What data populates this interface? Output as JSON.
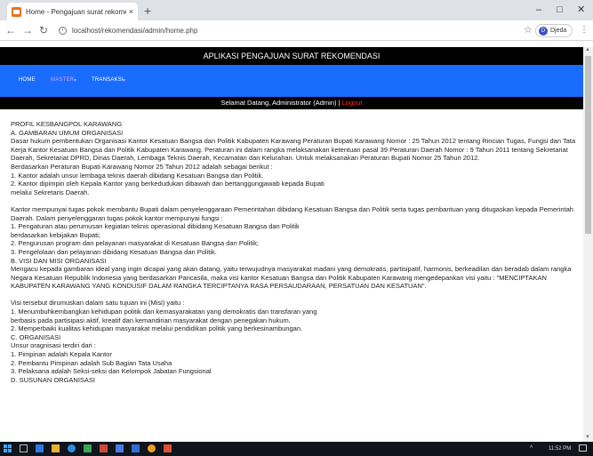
{
  "browser": {
    "tab_title": "Home - Pengajuan surat rekome",
    "tab_close": "×",
    "new_tab": "+",
    "url": "localhost/rekomendasi/admin/home.php",
    "profile_name": "Djeda",
    "profile_initial": "D",
    "minimize": "–",
    "maximize": "□",
    "close": "✕"
  },
  "page": {
    "app_title": "APLIKASI PENGAJUAN SURAT REKOMENDASI",
    "menu": [
      {
        "label": "HOME"
      },
      {
        "label": "MASTER"
      },
      {
        "label": "TRANSAKSI"
      }
    ],
    "welcome_text": "Selamat Datang, Administrator (Admin) | ",
    "logout": "Logout"
  },
  "content": {
    "lines": [
      "PROFIL KESBANGPOL KARAWANG",
      "A. GAMBARAN UMUM ORGANISASI",
      "Dasar hukum pembentukan Organisasi Kantor Kesatuan Bangsa dan Politik Kabupaten Karawang Peraturan Bupati Karawang Nomor : 25 Tahun 2012 tentang Rincian Tugas, Fungsi dan Tata Kerja Kantor Kesatuan Bangsa dan Politik Kabupaten Karawang. Peraturan ini dalam rangka melaksanakan ketentuan pasal 39 Peraturan Daerah Nomor : 9 Tahun 2011 tentang Sekretariat Daerah, Sekretariat DPRD, Dinas Daerah, Lembaga Teknis Daerah, Kecamatan dan Kelurahan. Untuk melaksanakan Peraturan Bupati Nomor 25 Tahun 2012.",
      "Berdasarkan Peraturan Bupati Karawang Nomor 25 Tahun 2012 adalah sebagai berikut :",
      "1. Kantor adalah unsur lembaga teknis daerah dibidang Kesatuan Bangsa dan Politik.",
      "2. Kantor dipimpin oleh Kepala Kantor yang berkedudukan dibawah dan bertanggungjawab kepada Bupati",
      "melalui Sekretaris Daerah.",
      "",
      "Kantor mempunyai tugas pokok membantu Bupati dalam penyelenggaraan Pemerintahan dibidang Kesatuan Bangsa dan Politik serta tugas pembantuan yang ditugaskan kepada Pemerintah Daerah. Dalam penyelenggaran tugas pokok kantor mempunyai fungsi :",
      "1. Pengaturan atau perumusan kegiatan teknis operasional dibidang Kesatuan Bangsa dan Politik",
      "berdasarkan kebijakan Bupati;",
      "2. Pengurusan program dan pelayanan masyarakat di Kesatuan Bangsa dan Politik;",
      "3. Pengelolaan dan pelayanan dibidang Kesatuan Bangsa dan Politik.",
      "B. VISI DAN MISI ORGANISASI",
      "Mengacu kepada gambaran ideal yang ingin dicapai yang akan datang, yaitu terwujudnya masyarakat madani yang demokratis, partisipatif, harmonis, berkeadilan dan beradab dalam rangka Negara Kesatuan Republik Indonesia yang berdasarkan Pancasila, maka visi kantor Kesatuan Bangsa dan Politik Kabupaten Karawang mengedepankan visi yaitu : \"MENCIPTAKAN KABUPATEN KARAWANG YANG KONDUSIF DALAM RANGKA TERCIPTANYA RASA PERSAUDARAAN, PERSATUAN DAN KESATUAN\".",
      "",
      "Visi tersebut dirumuskan dalam satu tujuan ini (Misi) yaitu :",
      "1. Menumbuhkembangkan kehidupan politik dan kemasyarakatan yang demokratis dan transfaran yang",
      "berbasis pada partisipasi aktif, kreatif dan kemandirian masyarakat dengan penegakan hukum.",
      "2. Memperbaiki kualitas kehidupan masyarakat melalui pendidikan politik yang berkesinambungan.",
      "C. ORGANISASI",
      "Unsur oragnisasi terdiri dari :",
      "1. Pimpinan adalah Kepala Kantor",
      "2. Pembantu Pimpinan adalah Sub Bagian Tata Usaha",
      "3. Pelaksana adalah Seksi-seksi dan Kelompok Jabatan Fungsional",
      "D. SUSUNAN ORGANISASI"
    ]
  },
  "taskbar": {
    "tray": "^",
    "time": "11:52 PM"
  },
  "colors": {
    "menubar": "#1a6cff",
    "header": "#000000",
    "logout": "#ff2a2a",
    "menu_text": "#ffffff",
    "menu_dim": "#c9a0ff"
  }
}
